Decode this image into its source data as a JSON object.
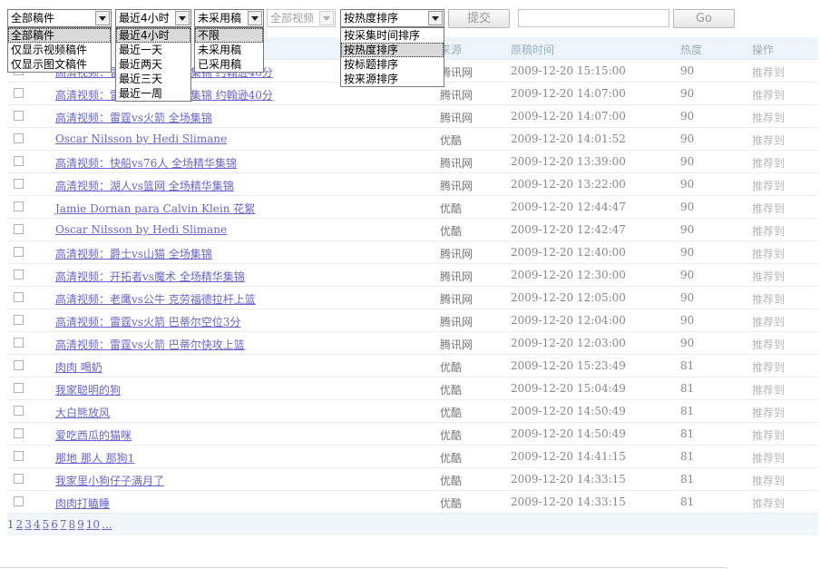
{
  "filters": {
    "type_select": {
      "value": "全部稿件",
      "options": [
        "全部稿件",
        "仅显示视频稿件",
        "仅显示图文稿件"
      ],
      "highlighted": 0
    },
    "time_select": {
      "value": "最近4小时",
      "options": [
        "最近4小时",
        "最近一天",
        "最近两天",
        "最近三天",
        "最近一周"
      ],
      "highlighted": 0
    },
    "status_select": {
      "value": "未采用稿",
      "options": [
        "不限",
        "未采用稿",
        "已采用稿"
      ],
      "highlighted": 0
    },
    "video_select": {
      "value": "全部视频"
    },
    "sort_select": {
      "value": "按热度排序",
      "options": [
        "按采集时间排序",
        "按热度排序",
        "按标题排序",
        "按来源排序"
      ],
      "highlighted": 1
    },
    "submit_label": "提交",
    "search_value": "",
    "go_label": "Go"
  },
  "columns": {
    "source": "来源",
    "time": "原稿时间",
    "hot": "热度",
    "action": "操作"
  },
  "rows": [
    {
      "title": "高清视频：雷霆vs火箭 全场集锦 约翰逊40分",
      "source": "腾讯网",
      "time": "2009-12-20 15:15:00",
      "hot": "90",
      "action": "推荐到"
    },
    {
      "title": "高清视频：雷霆vs火箭 全场集锦 约翰逊40分",
      "source": "腾讯网",
      "time": "2009-12-20 14:07:00",
      "hot": "90",
      "action": "推荐到"
    },
    {
      "title": "高清视频：雷霆vs火箭 全场集锦",
      "source": "腾讯网",
      "time": "2009-12-20 14:07:00",
      "hot": "90",
      "action": "推荐到"
    },
    {
      "title": "Oscar Nilsson by Hedi Slimane",
      "source": "优酷",
      "time": "2009-12-20 14:01:52",
      "hot": "90",
      "action": "推荐到"
    },
    {
      "title": "高清视频：快船vs76人 全场精华集锦",
      "source": "腾讯网",
      "time": "2009-12-20 13:39:00",
      "hot": "90",
      "action": "推荐到"
    },
    {
      "title": "高清视频：湖人vs篮网 全场精华集锦",
      "source": "腾讯网",
      "time": "2009-12-20 13:22:00",
      "hot": "90",
      "action": "推荐到"
    },
    {
      "title": "Jamie Dornan para Calvin Klein 花絮",
      "source": "优酷",
      "time": "2009-12-20 12:44:47",
      "hot": "90",
      "action": "推荐到"
    },
    {
      "title": "Oscar Nilsson by Hedi Slimane",
      "source": "优酷",
      "time": "2009-12-20 12:42:47",
      "hot": "90",
      "action": "推荐到"
    },
    {
      "title": "高清视频：爵士vs山猫 全场集锦",
      "source": "腾讯网",
      "time": "2009-12-20 12:40:00",
      "hot": "90",
      "action": "推荐到"
    },
    {
      "title": "高清视频：开拓者vs魔术 全场精华集锦",
      "source": "腾讯网",
      "time": "2009-12-20 12:30:00",
      "hot": "90",
      "action": "推荐到"
    },
    {
      "title": "高清视频：老鹰vs公牛 克劳福德拉杆上篮",
      "source": "腾讯网",
      "time": "2009-12-20 12:05:00",
      "hot": "90",
      "action": "推荐到"
    },
    {
      "title": "高清视频：雷霆vs火箭 巴蒂尔空位3分",
      "source": "腾讯网",
      "time": "2009-12-20 12:04:00",
      "hot": "90",
      "action": "推荐到"
    },
    {
      "title": "高清视频：雷霆vs火箭 巴蒂尔快攻上篮",
      "source": "腾讯网",
      "time": "2009-12-20 12:03:00",
      "hot": "90",
      "action": "推荐到"
    },
    {
      "title": "肉肉 喝奶",
      "source": "优酷",
      "time": "2009-12-20 15:23:49",
      "hot": "81",
      "action": "推荐到"
    },
    {
      "title": "我家聪明的狗",
      "source": "优酷",
      "time": "2009-12-20 15:04:49",
      "hot": "81",
      "action": "推荐到"
    },
    {
      "title": "大白熊放风",
      "source": "优酷",
      "time": "2009-12-20 14:50:49",
      "hot": "81",
      "action": "推荐到"
    },
    {
      "title": "爱吃西瓜的猫咪",
      "source": "优酷",
      "time": "2009-12-20 14:50:49",
      "hot": "81",
      "action": "推荐到"
    },
    {
      "title": "那地 那人 那狗1",
      "source": "优酷",
      "time": "2009-12-20 14:41:15",
      "hot": "81",
      "action": "推荐到"
    },
    {
      "title": "我家里小狗仔子满月了",
      "source": "优酷",
      "time": "2009-12-20 14:33:15",
      "hot": "81",
      "action": "推荐到"
    },
    {
      "title": "肉肉打瞌睡",
      "source": "优酷",
      "time": "2009-12-20 14:33:15",
      "hot": "81",
      "action": "推荐到"
    }
  ],
  "pager": {
    "pages": [
      "1",
      "2",
      "3",
      "4",
      "5",
      "6",
      "7",
      "8",
      "9",
      "10",
      "..."
    ],
    "current": "1"
  }
}
